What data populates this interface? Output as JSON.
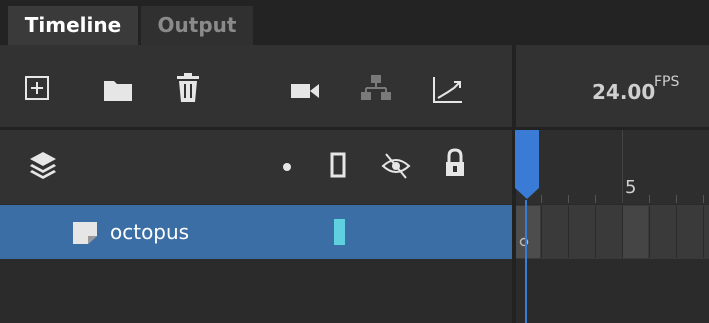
{
  "tabs": [
    {
      "label": "Timeline",
      "active": true
    },
    {
      "label": "Output",
      "active": false
    }
  ],
  "toolbar": {
    "icons": [
      "add-layer-icon",
      "folder-icon",
      "trash-icon",
      "camera-icon",
      "layer-parenting-icon",
      "graph-icon"
    ]
  },
  "fps": {
    "value": "24.00",
    "unit": "FPS"
  },
  "layer_header": {
    "icons": [
      "layers-icon",
      "dot-icon",
      "outline-icon",
      "hide-eye-icon",
      "lock-icon"
    ]
  },
  "ruler": {
    "frame_label": "5"
  },
  "layers": [
    {
      "name": "octopus",
      "color": "#5fd0e0",
      "selected": true
    }
  ],
  "colors": {
    "selection": "#3c6ea6",
    "playhead": "#3a7bd5"
  }
}
